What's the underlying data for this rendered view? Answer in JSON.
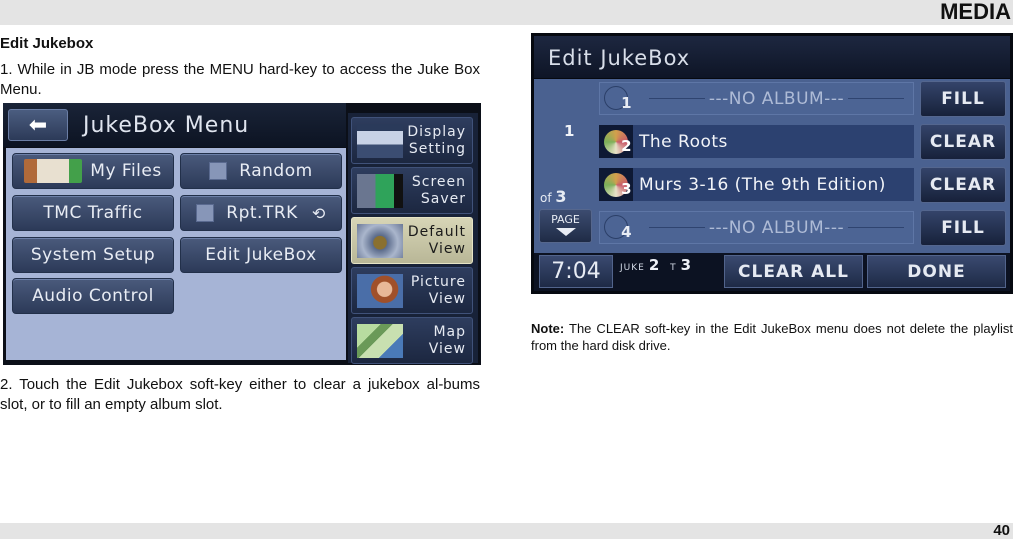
{
  "page": {
    "section_tag": "MEDIA",
    "page_number": "40"
  },
  "left": {
    "heading": "Edit Jukebox",
    "step1": "1. While in JB mode press the MENU hard-key to access the Juke Box Menu.",
    "step2": "2. Touch the Edit Jukebox soft-key either to clear a jukebox al-bums slot, or to fill an empty album slot."
  },
  "jukebox_menu_screen": {
    "title": "JukeBox Menu",
    "back_icon": "left-arrow-icon",
    "buttons": [
      {
        "label": "My Files",
        "icon": "files-thumbnail-icon"
      },
      {
        "label": "Random",
        "checkbox": false
      },
      {
        "label": "TMC Traffic"
      },
      {
        "label": "Rpt.TRK",
        "checkbox": false,
        "icon": "repeat-icon"
      },
      {
        "label": "System Setup"
      },
      {
        "label": "Edit JukeBox"
      },
      {
        "label": "Audio Control"
      }
    ],
    "side_buttons": [
      {
        "line1": "Display",
        "line2": "Setting",
        "icon": "display-setting-thumbnail",
        "active": false
      },
      {
        "line1": "Screen",
        "line2": "Saver",
        "icon": "screen-saver-thumbnail",
        "active": false
      },
      {
        "line1": "Default",
        "line2": "View",
        "icon": "default-view-thumbnail",
        "active": true
      },
      {
        "line1": "Picture",
        "line2": "View",
        "icon": "picture-thumbnail",
        "active": false
      },
      {
        "line1": "Map",
        "line2": "View",
        "icon": "map-thumbnail",
        "active": false
      }
    ]
  },
  "edit_jukebox_screen": {
    "title": "Edit JukeBox",
    "current_page": "1",
    "of_label": "of",
    "total_pages": "3",
    "page_button": "PAGE",
    "slots": [
      {
        "number": "1",
        "label": "---NO ALBUM---",
        "filled": false,
        "action": "FILL"
      },
      {
        "number": "2",
        "label": "The Roots",
        "filled": true,
        "action": "CLEAR"
      },
      {
        "number": "3",
        "label": "Murs 3-16 (The 9th Edition)",
        "filled": true,
        "action": "CLEAR"
      },
      {
        "number": "4",
        "label": "---NO ALBUM---",
        "filled": false,
        "action": "FILL"
      }
    ],
    "clock": "7:04",
    "juke_label": "JUKE",
    "juke_number": "2",
    "track_label": "T",
    "track_number": "3",
    "clear_all": "CLEAR ALL",
    "done": "DONE"
  },
  "note": {
    "label": "Note:",
    "text": " The CLEAR soft-key in the Edit JukeBox menu does not delete the playlist from the hard disk drive."
  }
}
